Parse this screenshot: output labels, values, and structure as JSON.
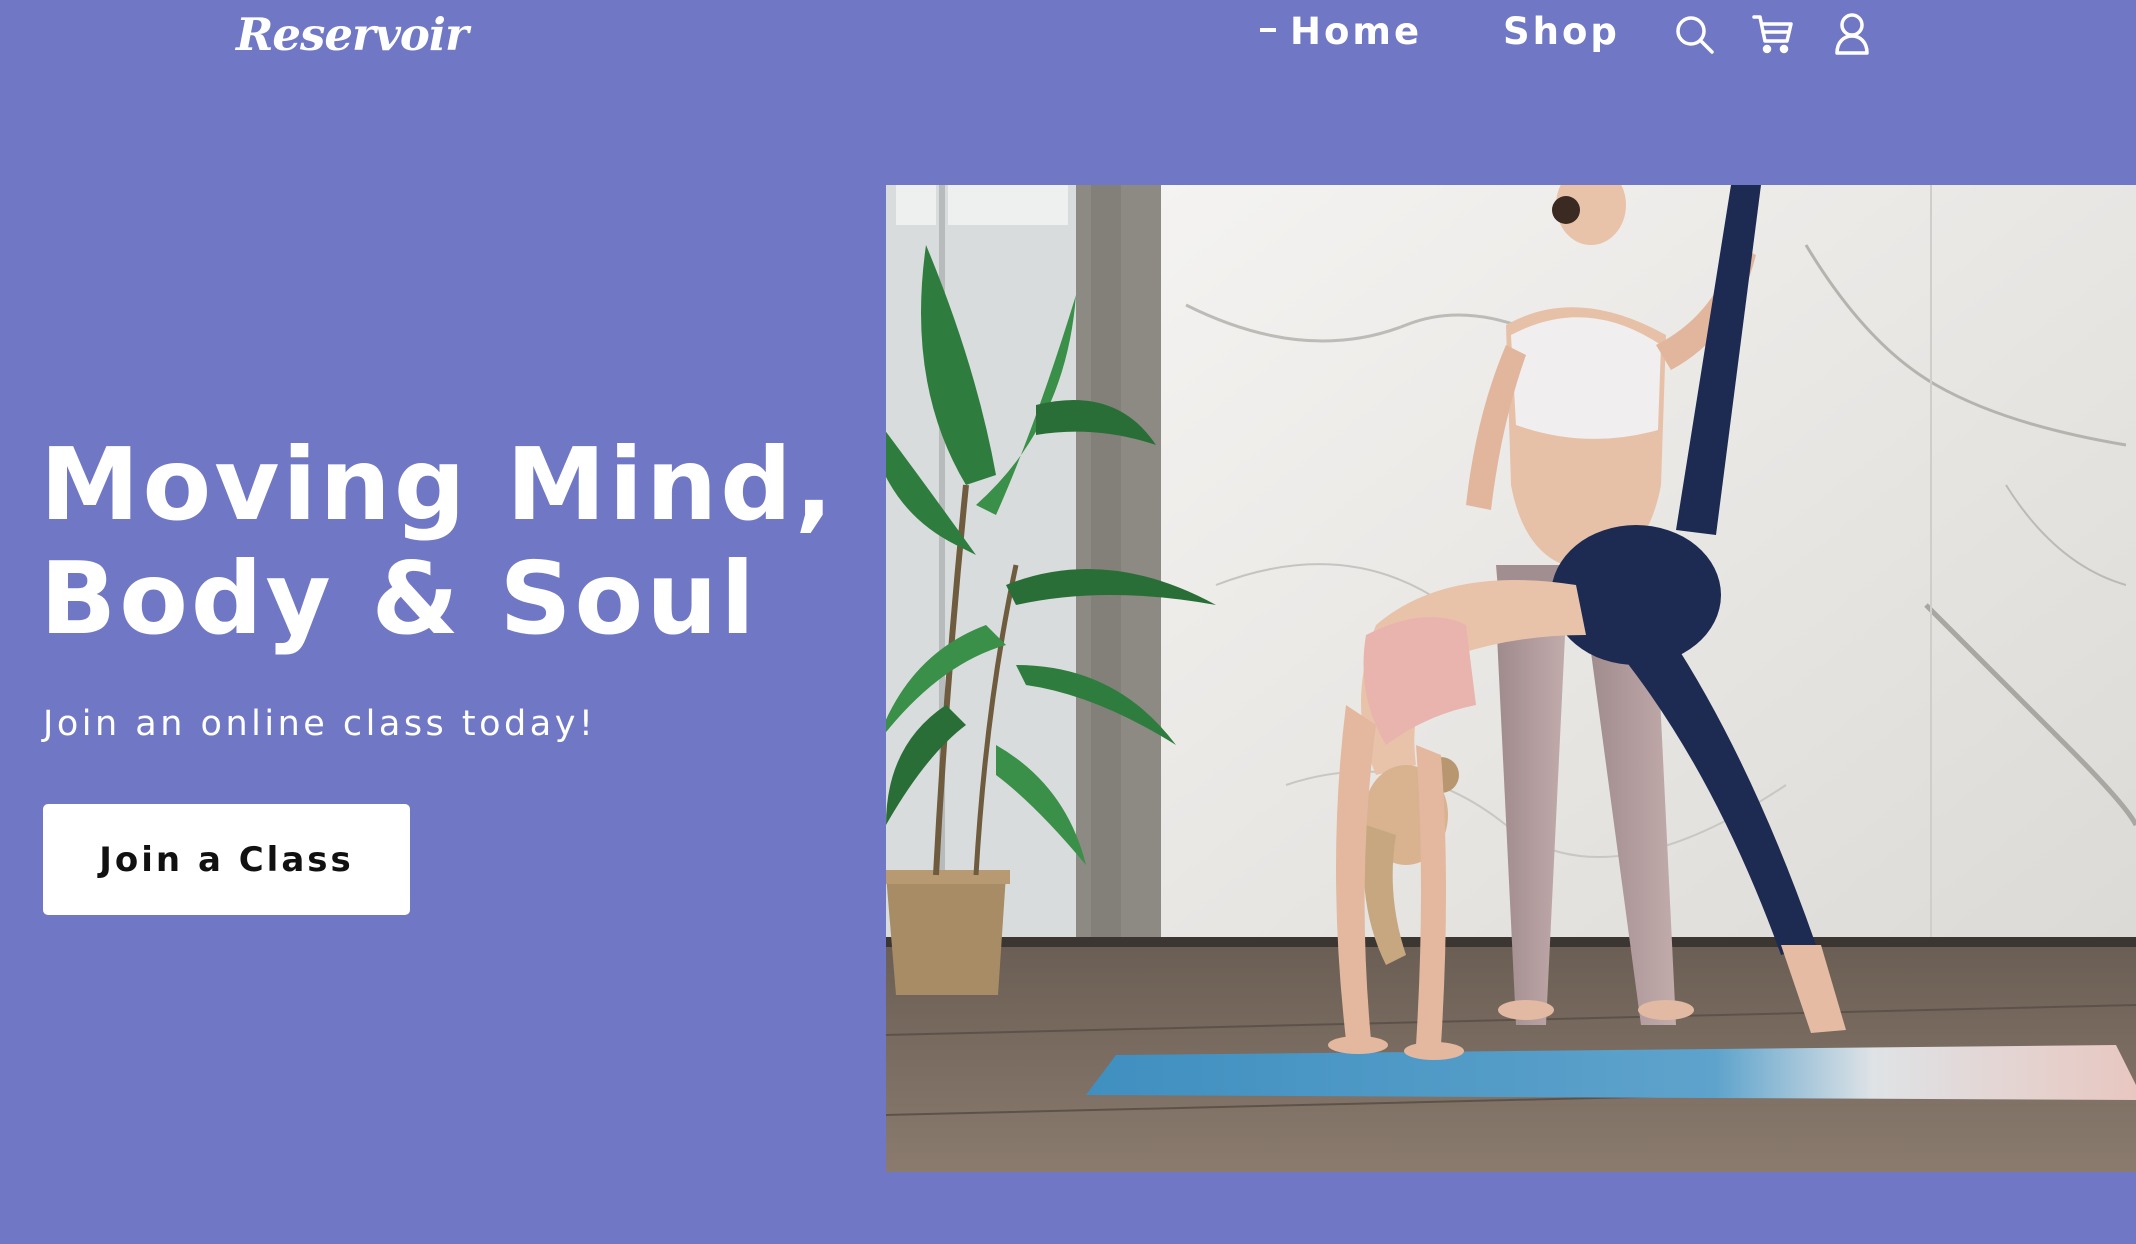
{
  "brand": {
    "logo_text": "Reservoir"
  },
  "nav": {
    "items": [
      {
        "label": "Home",
        "active": true
      },
      {
        "label": "Shop",
        "active": false
      }
    ],
    "icons": [
      "search-icon",
      "cart-icon",
      "account-icon"
    ]
  },
  "hero": {
    "title_line1": "Moving Mind,",
    "title_line2": "Body & Soul",
    "subtitle": "Join an online class today!",
    "cta_label": "Join a Class",
    "image_alt": "Yoga instructor assisting a student in a backbend pose on a blue mat"
  },
  "colors": {
    "background": "#7078c5",
    "text": "#ffffff",
    "button_bg": "#ffffff",
    "button_text": "#111111"
  }
}
